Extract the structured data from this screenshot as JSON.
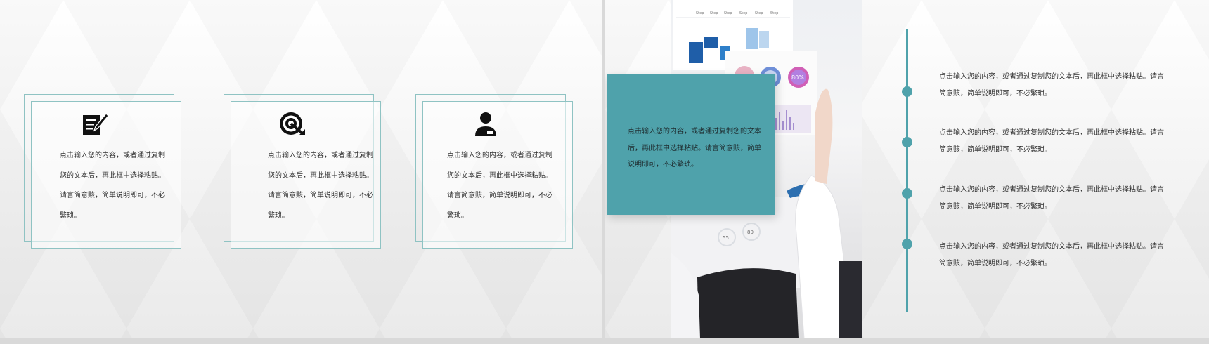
{
  "colors": {
    "accent": "#4fa2ab",
    "frame": "#8fc3c3",
    "text": "#333333"
  },
  "left_slide": {
    "cards": [
      {
        "icon": "edit-document-icon",
        "text": "点击输入您的内容，或者通过复制您的文本后，再此框中选择粘贴。请言简意赅，简单说明即可，不必繁琐。"
      },
      {
        "icon": "target-icon",
        "text": "点击输入您的内容，或者通过复制您的文本后，再此框中选择粘贴。请言简意赅，简单说明即可，不必繁琐。"
      },
      {
        "icon": "user-icon",
        "text": "点击输入您的内容，或者通过复制您的文本后，再此框中选择粘贴。请言简意赅，简单说明即可，不必繁琐。"
      }
    ]
  },
  "right_slide": {
    "photo": {
      "tabs": [
        "Step",
        "Step",
        "Step",
        "Step",
        "Step",
        "Step"
      ],
      "percent_label": "80%",
      "gauge_a": "55",
      "gauge_b": "80"
    },
    "teal_box_text": "点击输入您的内容，或者通过复制您的文本后，再此框中选择粘贴。请言简意赅，简单说明即可，不必繁琐。",
    "timeline": [
      {
        "text": "点击输入您的内容，或者通过复制您的文本后，再此框中选择粘贴。请言简意赅，简单说明即可，不必繁琐。"
      },
      {
        "text": "点击输入您的内容，或者通过复制您的文本后，再此框中选择粘贴。请言简意赅，简单说明即可，不必繁琐。"
      },
      {
        "text": "点击输入您的内容，或者通过复制您的文本后，再此框中选择粘贴。请言简意赅，简单说明即可，不必繁琐。"
      },
      {
        "text": "点击输入您的内容，或者通过复制您的文本后，再此框中选择粘贴。请言简意赅，简单说明即可，不必繁琐。"
      }
    ]
  }
}
